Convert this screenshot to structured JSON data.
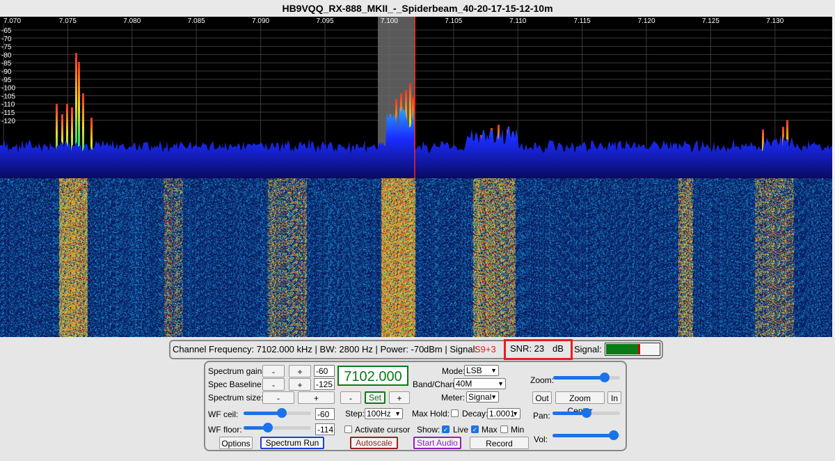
{
  "window": {
    "title": "HB9VQQ_RX-888_MKII_-_Spiderbeam_40-20-17-15-12-10m"
  },
  "spectrum": {
    "x_axis_labels": [
      "7.070",
      "7.075",
      "7.080",
      "7.085",
      "7.090",
      "7.095",
      "7.100",
      "7.105",
      "7.110",
      "7.115",
      "7.120",
      "7.125",
      "7.130"
    ],
    "y_axis_labels": [
      "-65",
      "-70",
      "-75",
      "-80",
      "-85",
      "-90",
      "-95",
      "-100",
      "-105",
      "-110",
      "-115",
      "-120"
    ],
    "colors": {
      "grid": "#3a3a3a",
      "noise_floor": "#1a2cff",
      "passband": "#6a6a6a",
      "marker": "#ff2020"
    }
  },
  "info_bar": {
    "channel": "Channel Frequency: 7102.000 kHz | BW: 2800 Hz | Power: -70",
    "power_unit": "dBm | Signal:",
    "signal_value": "S9+3",
    "snr_label": "SNR: 23",
    "snr_unit": "dB",
    "signal_label": "Signal:",
    "signal_level": 0.6
  },
  "controls": {
    "spectrum_gain": {
      "label": "Spectrum gain:",
      "minus": "-",
      "plus": "+",
      "value": "-60"
    },
    "spec_baseline": {
      "label": "Spec Baseline:",
      "minus": "-",
      "plus": "+",
      "value": "-125"
    },
    "spectrum_size": {
      "label": "Spectrum size:",
      "minus": "-",
      "plus": "+"
    },
    "frequency_display": "7102.000",
    "freq_minus": "-",
    "freq_set": "Set",
    "freq_plus": "+",
    "wf_ceil": {
      "label": "WF ceil:",
      "value": "-60",
      "level": 0.58
    },
    "wf_floor": {
      "label": "WF floor:",
      "value": "-114",
      "level": 0.34
    },
    "options_button": "Options",
    "spectrum_run_button": "Spectrum Run",
    "step": {
      "label": "Step:",
      "value": "100Hz"
    },
    "activate_cursor": "Activate cursor",
    "autoscale_button": "Autoscale",
    "mode": {
      "label": "Mode:",
      "value": "LSB"
    },
    "band_chan": {
      "label": "Band/Chan:",
      "value": "40M"
    },
    "meter": {
      "label": "Meter:",
      "value": "Signal"
    },
    "max_hold": "Max Hold:",
    "decay": {
      "label": "Decay:",
      "value": "1.0001"
    },
    "show": {
      "label": "Show:",
      "live": "Live",
      "max": "Max",
      "min": "Min"
    },
    "start_audio_button": "Start Audio",
    "record_button": "Record",
    "zoom": {
      "label": "Zoom:",
      "level": 0.82
    },
    "zoom_out": "Out",
    "zoom_center": "Zoom Center",
    "zoom_in": "In",
    "pan": {
      "label": "Pan:",
      "level": 0.5
    },
    "vol": {
      "label": "Vol:",
      "level": 0.97
    }
  }
}
